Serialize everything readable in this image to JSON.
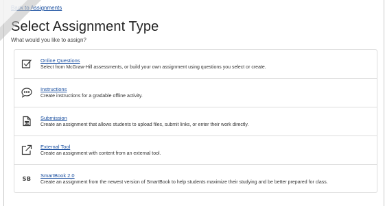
{
  "header": {
    "back_link": "Back to Assignments",
    "title": "Select Assignment Type",
    "subtitle": "What would you like to assign?"
  },
  "options": [
    {
      "icon": "checkbox-check-icon",
      "title": "Online Questions",
      "description": "Select from McGraw-Hill assessments, or build your own assignment using questions you select or create."
    },
    {
      "icon": "speech-bubble-icon",
      "title": "Instructions",
      "description": "Create instructions for a gradable offline activity."
    },
    {
      "icon": "document-icon",
      "title": "Submission",
      "description": "Create an assignment that allows students to upload files, submit links, or enter their work directly."
    },
    {
      "icon": "external-link-icon",
      "title": "External Tool",
      "description": "Create an assignment with content from an external tool."
    },
    {
      "icon": "smartbook-icon",
      "icon_text": "SB",
      "title": "SmartBook 2.0",
      "description": "Create an assignment from the newest version of SmartBook to help students maximize their studying and be better prepared for class."
    }
  ],
  "colors": {
    "link": "#1a4fa0",
    "text": "#333333",
    "border": "#dcdcdc"
  }
}
